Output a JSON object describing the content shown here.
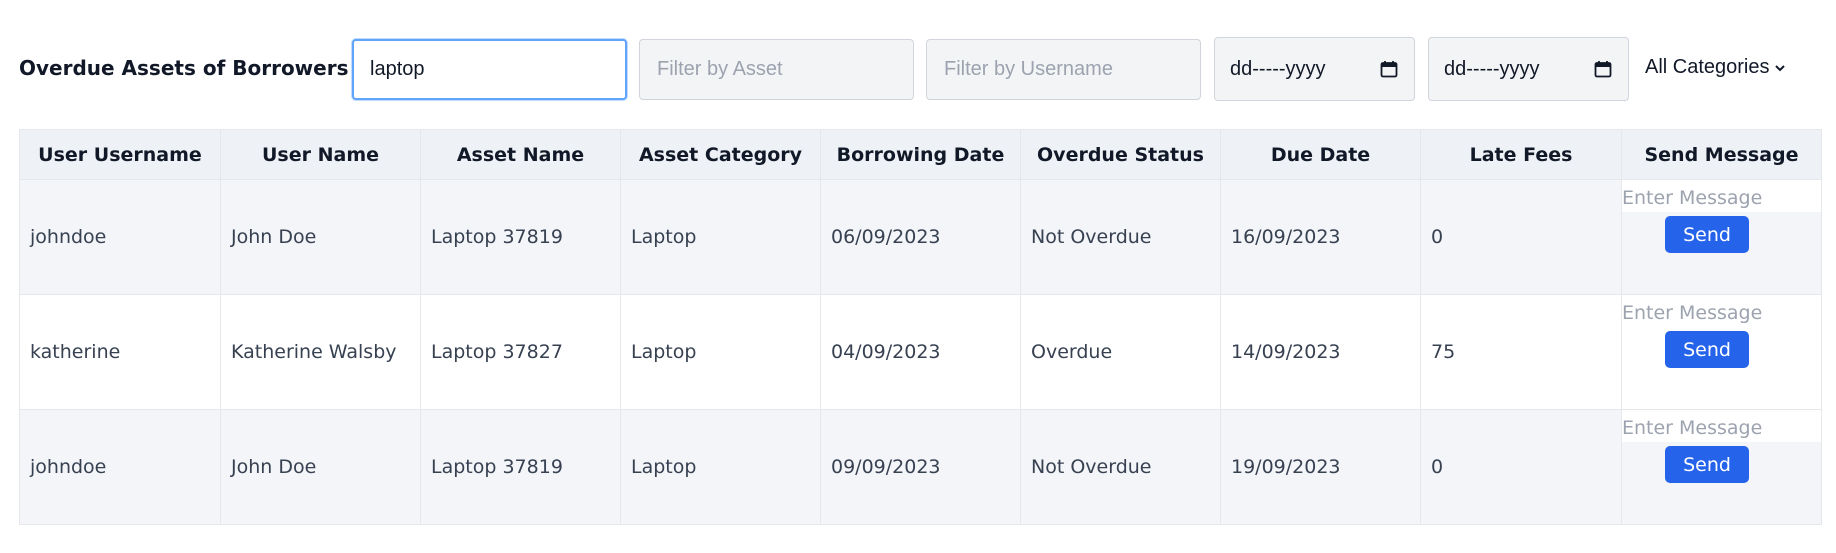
{
  "page": {
    "title": "Overdue Assets of Borrowers"
  },
  "filters": {
    "search_value": "laptop",
    "asset_placeholder": "Filter by Asset",
    "username_placeholder": "Filter by Username",
    "date_from_text": "dd-----yyyy",
    "date_to_text": "dd-----yyyy",
    "category_selected": "All Categories"
  },
  "table": {
    "columns": [
      "User Username",
      "User Name",
      "Asset Name",
      "Asset Category",
      "Borrowing Date",
      "Overdue Status",
      "Due Date",
      "Late Fees",
      "Send Message"
    ],
    "message_placeholder": "Enter Message",
    "send_label": "Send",
    "rows": [
      {
        "username": "johndoe",
        "name": "John Doe",
        "asset": "Laptop 37819",
        "category": "Laptop",
        "borrow_date": "06/09/2023",
        "status": "Not Overdue",
        "due_date": "16/09/2023",
        "late_fees": "0"
      },
      {
        "username": "katherine",
        "name": "Katherine Walsby",
        "asset": "Laptop 37827",
        "category": "Laptop",
        "borrow_date": "04/09/2023",
        "status": "Overdue",
        "due_date": "14/09/2023",
        "late_fees": "75"
      },
      {
        "username": "johndoe",
        "name": "John Doe",
        "asset": "Laptop 37819",
        "category": "Laptop",
        "borrow_date": "09/09/2023",
        "status": "Not Overdue",
        "due_date": "19/09/2023",
        "late_fees": "0"
      }
    ]
  },
  "colors": {
    "accent": "#2563eb",
    "header_bg": "#eef2f6",
    "row_shade": "#f3f5f8",
    "focus_border": "#60a5fa"
  },
  "icons": {
    "date": "calendar-icon",
    "dropdown": "chevron-down-icon"
  }
}
